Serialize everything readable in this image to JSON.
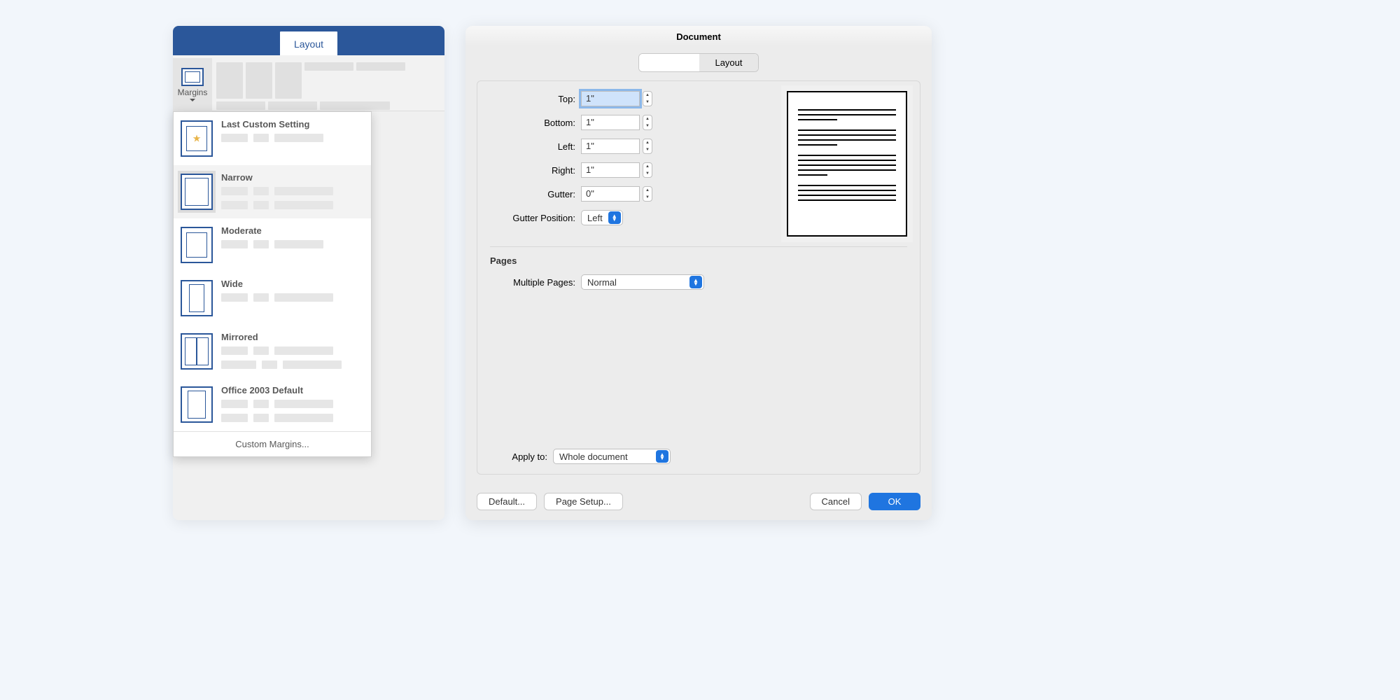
{
  "ribbon": {
    "tab_label": "Layout",
    "margins_label": "Margins"
  },
  "dropdown": {
    "items": [
      {
        "title": "Last Custom Setting",
        "icon": "star"
      },
      {
        "title": "Narrow",
        "icon": "narrow"
      },
      {
        "title": "Moderate",
        "icon": "moderate"
      },
      {
        "title": "Wide",
        "icon": "wide"
      },
      {
        "title": "Mirrored",
        "icon": "mirrored"
      },
      {
        "title": "Office 2003 Default",
        "icon": "office2003"
      }
    ],
    "selected_index": 1,
    "footer": "Custom Margins..."
  },
  "dialog": {
    "title": "Document",
    "segmented": {
      "blank": "",
      "layout": "Layout"
    },
    "margins": {
      "top_label": "Top:",
      "top_value": "1\"",
      "bottom_label": "Bottom:",
      "bottom_value": "1\"",
      "left_label": "Left:",
      "left_value": "1\"",
      "right_label": "Right:",
      "right_value": "1\"",
      "gutter_label": "Gutter:",
      "gutter_value": "0\"",
      "gutter_pos_label": "Gutter Position:",
      "gutter_pos_value": "Left"
    },
    "pages": {
      "heading": "Pages",
      "multiple_label": "Multiple Pages:",
      "multiple_value": "Normal"
    },
    "apply": {
      "label": "Apply to:",
      "value": "Whole document"
    },
    "buttons": {
      "default": "Default...",
      "page_setup": "Page Setup...",
      "cancel": "Cancel",
      "ok": "OK"
    }
  }
}
